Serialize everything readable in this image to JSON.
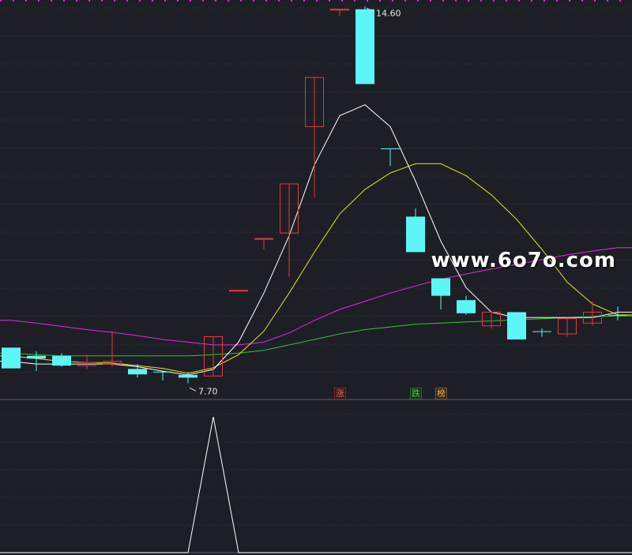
{
  "chart_data": {
    "type": "candlestick",
    "candles": [
      {
        "o": 8.35,
        "h": 8.35,
        "l": 7.97,
        "c": 7.97,
        "up": false
      },
      {
        "o": 8.2,
        "h": 8.28,
        "l": 7.92,
        "c": 8.15,
        "up": false
      },
      {
        "o": 8.2,
        "h": 8.25,
        "l": 8.0,
        "c": 8.02,
        "up": false
      },
      {
        "o": 8.08,
        "h": 8.22,
        "l": 7.95,
        "c": 8.02,
        "up": true
      },
      {
        "o": 8.05,
        "h": 8.65,
        "l": 8.0,
        "c": 8.1,
        "up": true
      },
      {
        "o": 7.96,
        "h": 8.05,
        "l": 7.8,
        "c": 7.86,
        "up": false
      },
      {
        "o": 7.91,
        "h": 7.91,
        "l": 7.75,
        "c": 7.91,
        "up": false
      },
      {
        "o": 7.85,
        "h": 7.9,
        "l": 7.7,
        "c": 7.8,
        "up": false
      },
      {
        "o": 7.83,
        "h": 8.55,
        "l": 7.83,
        "c": 8.55,
        "up": true
      },
      {
        "o": 9.4,
        "h": 9.4,
        "l": 9.4,
        "c": 9.4,
        "up": true
      },
      {
        "o": 10.35,
        "h": 10.35,
        "l": 10.15,
        "c": 10.35,
        "up": true
      },
      {
        "o": 10.45,
        "h": 11.35,
        "l": 9.65,
        "c": 11.35,
        "up": true
      },
      {
        "o": 12.4,
        "h": 13.3,
        "l": 11.1,
        "c": 13.3,
        "up": true
      },
      {
        "o": 14.55,
        "h": 14.55,
        "l": 14.43,
        "c": 14.55,
        "up": true
      },
      {
        "o": 14.55,
        "h": 14.6,
        "l": 13.18,
        "c": 13.18,
        "up": false
      },
      {
        "o": 12.0,
        "h": 12.0,
        "l": 11.68,
        "c": 12.0,
        "up": false
      },
      {
        "o": 10.75,
        "h": 10.9,
        "l": 10.1,
        "c": 10.1,
        "up": false
      },
      {
        "o": 9.62,
        "h": 9.6,
        "l": 9.05,
        "c": 9.3,
        "up": false
      },
      {
        "o": 9.22,
        "h": 9.3,
        "l": 8.95,
        "c": 8.98,
        "up": false
      },
      {
        "o": 9.0,
        "h": 9.0,
        "l": 8.7,
        "c": 8.75,
        "up": true
      },
      {
        "o": 9.0,
        "h": 9.0,
        "l": 8.5,
        "c": 8.5,
        "up": false
      },
      {
        "o": 8.65,
        "h": 8.7,
        "l": 8.55,
        "c": 8.65,
        "up": false
      },
      {
        "o": 8.6,
        "h": 8.9,
        "l": 8.55,
        "c": 8.88,
        "up": true
      },
      {
        "o": 8.8,
        "h": 9.2,
        "l": 8.75,
        "c": 9.0,
        "up": true
      },
      {
        "o": 8.95,
        "h": 9.1,
        "l": 8.85,
        "c": 8.95,
        "up": false
      }
    ],
    "ma_white": [
      8.1,
      8.05,
      8.05,
      8.05,
      8.05,
      8.0,
      7.92,
      7.85,
      7.95,
      8.45,
      9.35,
      10.4,
      11.7,
      12.6,
      12.8,
      12.4,
      11.4,
      10.3,
      9.45,
      9.0,
      8.9,
      8.9,
      8.9,
      8.9,
      9.0
    ],
    "ma_yellow": [
      8.2,
      8.15,
      8.1,
      8.08,
      8.07,
      8.02,
      7.97,
      7.88,
      7.98,
      8.22,
      8.65,
      9.35,
      10.1,
      10.8,
      11.25,
      11.55,
      11.72,
      11.72,
      11.5,
      11.15,
      10.7,
      10.15,
      9.55,
      9.15,
      8.95
    ],
    "ma_magenta": [
      8.85,
      8.8,
      8.74,
      8.68,
      8.63,
      8.57,
      8.5,
      8.45,
      8.4,
      8.4,
      8.45,
      8.62,
      8.85,
      9.05,
      9.2,
      9.35,
      9.48,
      9.6,
      9.7,
      9.79,
      9.88,
      9.96,
      10.05,
      10.12,
      10.18
    ],
    "ma_green": [
      8.25,
      8.22,
      8.2,
      8.2,
      8.2,
      8.2,
      8.2,
      8.2,
      8.22,
      8.25,
      8.3,
      8.4,
      8.5,
      8.6,
      8.68,
      8.73,
      8.78,
      8.8,
      8.82,
      8.84,
      8.86,
      8.88,
      8.9,
      8.92,
      8.93
    ],
    "max_label": "14.60",
    "min_label": "7.70",
    "markers": [
      {
        "index": 13,
        "text": "涨",
        "kind": "up"
      },
      {
        "index": 16,
        "text": "跌",
        "kind": "down"
      },
      {
        "index": 17,
        "text": "榜",
        "kind": "list"
      }
    ],
    "lower_indicator": [
      0,
      0,
      0,
      0,
      0,
      0,
      0,
      0,
      1,
      0,
      0,
      0,
      0,
      0,
      0,
      0,
      0,
      0,
      0,
      0,
      0,
      0,
      0,
      0,
      0
    ],
    "colors": {
      "up": "#e03a3a",
      "down": "#5cf6f6",
      "ma_white": "#ffffff",
      "ma_yellow": "#e8e21a",
      "ma_magenta": "#e02ae0",
      "ma_green": "#2ec42e",
      "grid": "#3a3c48",
      "bg": "#1e1f26"
    }
  },
  "watermark": "www.6o7o.com"
}
